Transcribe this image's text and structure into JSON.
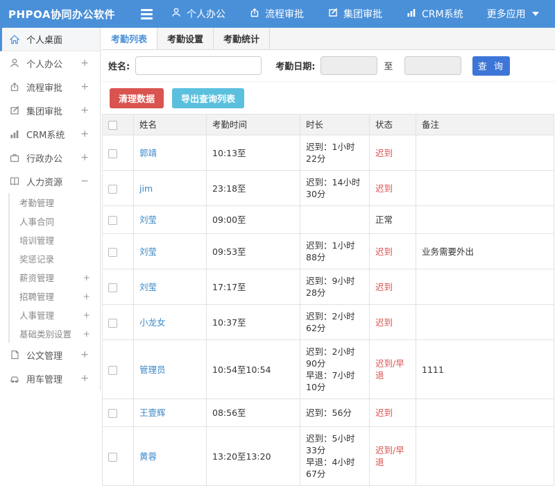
{
  "app": {
    "title": "PHPOA协同办公软件"
  },
  "topnav": {
    "items": [
      {
        "label": "个人办公",
        "icon": "person-icon"
      },
      {
        "label": "流程审批",
        "icon": "flow-icon"
      },
      {
        "label": "集团审批",
        "icon": "edit-icon"
      },
      {
        "label": "CRM系统",
        "icon": "chart-icon"
      },
      {
        "label": "更多应用",
        "icon": "caret-down-icon"
      }
    ]
  },
  "sidebar": {
    "items": [
      {
        "label": "个人桌面",
        "icon": "home-icon",
        "active": true
      },
      {
        "label": "个人办公",
        "icon": "person-icon",
        "expand": "+"
      },
      {
        "label": "流程审批",
        "icon": "flow-icon",
        "expand": "+"
      },
      {
        "label": "集团审批",
        "icon": "edit-icon",
        "expand": "+"
      },
      {
        "label": "CRM系统",
        "icon": "chart-icon",
        "expand": "+"
      },
      {
        "label": "行政办公",
        "icon": "briefcase-icon",
        "expand": "+"
      },
      {
        "label": "人力资源",
        "icon": "book-icon",
        "expand": "−"
      },
      {
        "label": "公文管理",
        "icon": "document-icon",
        "expand": "+"
      },
      {
        "label": "用车管理",
        "icon": "car-icon",
        "expand": "+"
      }
    ],
    "hr_submenu": [
      {
        "label": "考勤管理",
        "expand": ""
      },
      {
        "label": "人事合同",
        "expand": ""
      },
      {
        "label": "培训管理",
        "expand": ""
      },
      {
        "label": "奖惩记录",
        "expand": ""
      },
      {
        "label": "薪资管理",
        "expand": "+"
      },
      {
        "label": "招聘管理",
        "expand": "+"
      },
      {
        "label": "人事管理",
        "expand": "+"
      },
      {
        "label": "基础类别设置",
        "expand": "+"
      }
    ]
  },
  "tabs": [
    {
      "label": "考勤列表",
      "active": true
    },
    {
      "label": "考勤设置",
      "active": false
    },
    {
      "label": "考勤统计",
      "active": false
    }
  ],
  "search": {
    "name_label": "姓名:",
    "name_value": "",
    "date_label": "考勤日期:",
    "date_from_value": "",
    "to_label": "至",
    "date_to_value": "",
    "query_button": "查 询"
  },
  "actions": {
    "clean_button": "清理数据",
    "export_button": "导出查询列表"
  },
  "table": {
    "headers": [
      "姓名",
      "考勤时间",
      "时长",
      "状态",
      "备注"
    ],
    "rows": [
      {
        "name": "郭靖",
        "time": "10:13至",
        "duration": [
          "迟到：1小时22分"
        ],
        "status": "迟到",
        "status_style": "late",
        "note": ""
      },
      {
        "name": "jim",
        "time": "23:18至",
        "duration": [
          "迟到：14小时30分"
        ],
        "status": "迟到",
        "status_style": "late",
        "note": ""
      },
      {
        "name": "刘莹",
        "time": "09:00至",
        "duration": [],
        "status": "正常",
        "status_style": "normal",
        "note": ""
      },
      {
        "name": "刘莹",
        "time": "09:53至",
        "duration": [
          "迟到：1小时88分"
        ],
        "status": "迟到",
        "status_style": "late",
        "note": "业务需要外出"
      },
      {
        "name": "刘莹",
        "time": "17:17至",
        "duration": [
          "迟到：9小时28分"
        ],
        "status": "迟到",
        "status_style": "late",
        "note": ""
      },
      {
        "name": "小龙女",
        "time": "10:37至",
        "duration": [
          "迟到：2小时62分"
        ],
        "status": "迟到",
        "status_style": "late",
        "note": ""
      },
      {
        "name": "管理员",
        "time": "10:54至10:54",
        "duration": [
          "迟到：2小时90分",
          "早退：7小时10分"
        ],
        "status": "迟到/早退",
        "status_style": "late",
        "note": "1111"
      },
      {
        "name": "王壹辉",
        "time": "08:56至",
        "duration": [
          "迟到：56分"
        ],
        "status": "迟到",
        "status_style": "late",
        "note": ""
      },
      {
        "name": "黄蓉",
        "time": "13:20至13:20",
        "duration": [
          "迟到：5小时33分",
          "早退：4小时67分"
        ],
        "status": "迟到/早退",
        "status_style": "late",
        "note": ""
      }
    ]
  },
  "colors": {
    "topbar_blue": "#4a90d9",
    "query_button_blue": "#3e76d8",
    "danger_red": "#d9534f",
    "info_teal": "#5bc0de",
    "link_blue": "#3a87c8",
    "late_red": "#d9534f"
  }
}
